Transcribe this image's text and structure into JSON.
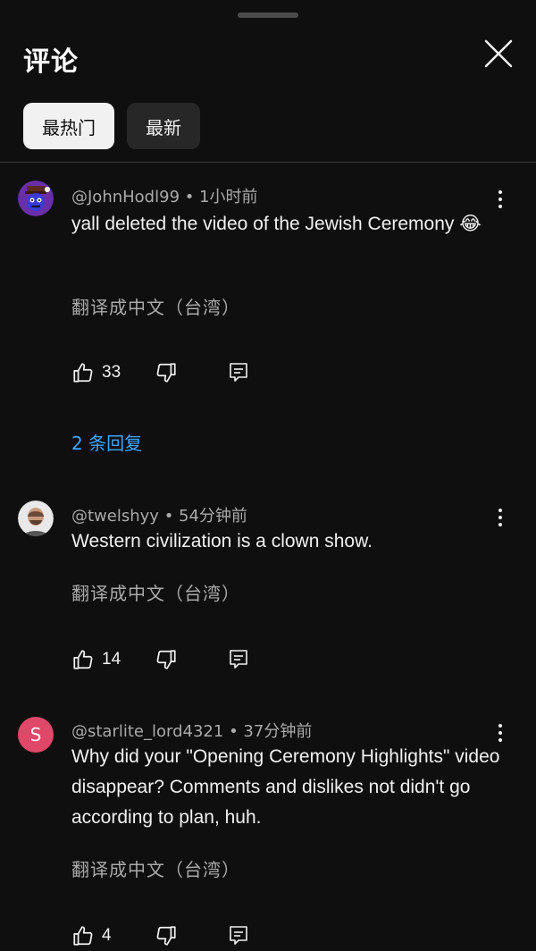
{
  "header": {
    "title": "评论"
  },
  "tabs": [
    {
      "label": "最热门",
      "active": true
    },
    {
      "label": "最新",
      "active": false
    }
  ],
  "comments": [
    {
      "author": "@JohnHodl99",
      "time": "1小时前",
      "text": "yall deleted the video of the Jewish Ceremony 😂",
      "translate": "翻译成中文（台湾）",
      "likes": "33",
      "replies": "2 条回复",
      "avatar": {
        "type": "image",
        "icon": "purple-character-avatar"
      }
    },
    {
      "author": "@twelshyy",
      "time": "54分钟前",
      "text": "Western civilization is a clown show.",
      "translate": "翻译成中文（台湾）",
      "likes": "14",
      "avatar": {
        "type": "image",
        "icon": "man-photo-avatar"
      }
    },
    {
      "author": "@starlite_lord4321",
      "time": "37分钟前",
      "text": "Why did your \"Opening Ceremony Highlights\" video disappear? Comments and dislikes not didn't go according to plan, huh.",
      "translate": "翻译成中文（台湾）",
      "likes": "4",
      "avatar": {
        "type": "letter",
        "letter": "S",
        "color": "#e0486a"
      }
    }
  ],
  "colors": {
    "background": "#0f0f0f",
    "link": "#3ea6ff",
    "muted": "#aaaaaa",
    "text": "#f1f1f1"
  }
}
